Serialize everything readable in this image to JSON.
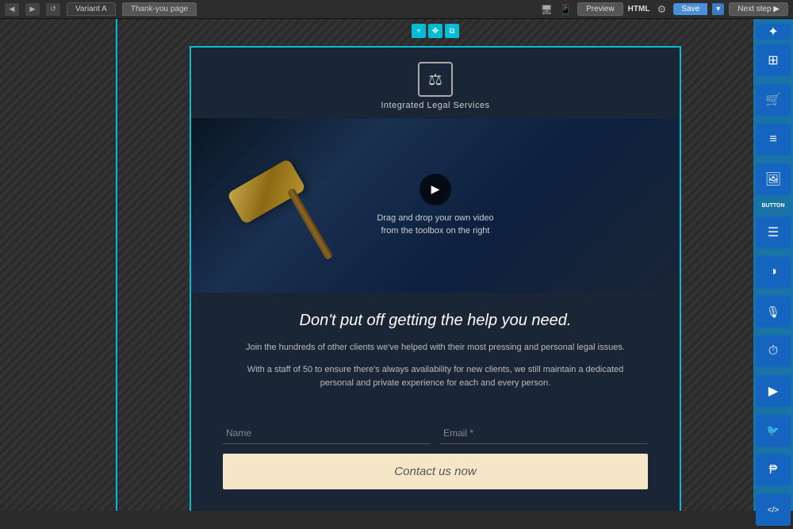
{
  "toolbar": {
    "back_label": "◀",
    "forward_label": "▶",
    "refresh_label": "↺",
    "tab_variant": "Variant A",
    "tab_thankyou": "Thank-you page",
    "preview_label": "Preview",
    "html_label": "HTML",
    "save_label": "Save",
    "save_dropdown": "▾",
    "nextstep_label": "Next step ▶"
  },
  "canvas": {
    "float_plus": "+",
    "float_move": "✥",
    "float_copy": "⧉"
  },
  "page": {
    "logo_icon": "⚖",
    "logo_text": "Integrated Legal Services",
    "video_caption_line1": "Drag and drop your own video",
    "video_caption_line2": "from the toolbox on the right",
    "play_icon": "▶",
    "heading": "Don't put off getting the help you need.",
    "subtext1": "Join the hundreds of other clients we've helped with their most pressing and personal legal issues.",
    "subtext2": "With a staff of 50 to ensure there's always availability for new clients, we still maintain a dedicated personal and private experience for each and every person.",
    "form": {
      "name_placeholder": "Name",
      "email_placeholder": "Email *",
      "contact_btn": "Contact us now"
    }
  },
  "right_tools": [
    {
      "icon": "✦",
      "label": ""
    },
    {
      "icon": "⊞",
      "label": ""
    },
    {
      "icon": "🛒",
      "label": ""
    },
    {
      "icon": "≡",
      "label": ""
    },
    {
      "icon": "🖼",
      "label": ""
    },
    {
      "icon": "BUTTON",
      "label": ""
    },
    {
      "icon": "☰",
      "label": ""
    },
    {
      "icon": "◑",
      "label": ""
    },
    {
      "icon": "🎙",
      "label": ""
    },
    {
      "icon": "⏱",
      "label": ""
    },
    {
      "icon": "▶",
      "label": ""
    },
    {
      "icon": "🐦",
      "label": ""
    },
    {
      "icon": "₱",
      "label": ""
    },
    {
      "icon": "</>",
      "label": ""
    }
  ]
}
